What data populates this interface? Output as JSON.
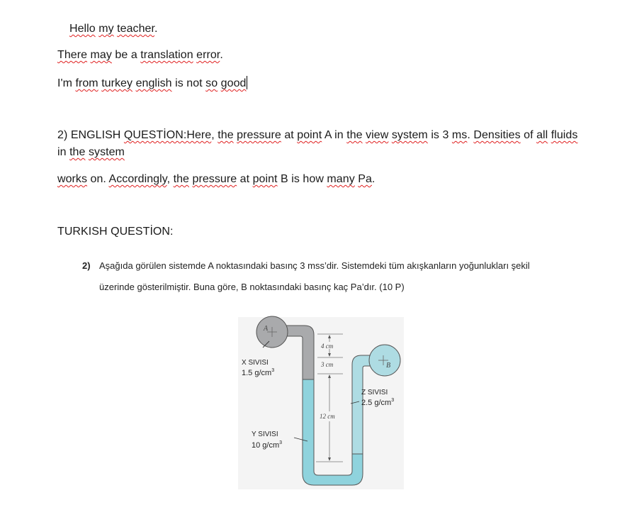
{
  "intro": {
    "line1": [
      "Hello",
      " ",
      "my",
      " ",
      "teacher",
      "."
    ],
    "line2": [
      "There",
      " ",
      "may",
      " be a ",
      "translation",
      " ",
      "error",
      "."
    ],
    "line3": [
      "I'm ",
      "from",
      " ",
      "turkey",
      " ",
      "english",
      " is not ",
      "so",
      " ",
      "good"
    ]
  },
  "english_question": {
    "line1": [
      "2) ENGLISH ",
      "QUESTİON:Here",
      ", ",
      "the",
      " ",
      "pressure",
      " at ",
      "point",
      " A in ",
      "the",
      " ",
      "view",
      " ",
      "system",
      " is 3 ",
      "ms",
      ". ",
      "Densities",
      " of ",
      "all",
      " ",
      "fluids"
    ],
    "line2": [
      "in ",
      "the",
      " ",
      "system"
    ],
    "line3": [
      "works",
      " on. ",
      "Accordingly",
      ", ",
      "the",
      " ",
      "pressure",
      " at ",
      "point",
      " B is how ",
      "many",
      " ",
      "Pa",
      "."
    ]
  },
  "turkish_heading": "TURKISH QUESTİON:",
  "turkish_question": {
    "number": "2)",
    "line1": "Aşağıda görülen sistemde A noktasındaki basınç 3 mss’dir. Sistemdeki tüm akışkanların yoğunlukları şekil",
    "line2": "üzerinde gösterilmiştir. Buna göre, B noktasındaki basınç kaç Pa’dır. (10 P)"
  },
  "diagram": {
    "point_a": "A",
    "point_b": "B",
    "fluid_x": {
      "name": "X SIVISI",
      "density": "1.5 g/cm",
      "sup": "3",
      "color": "#a9aaac"
    },
    "fluid_y": {
      "name": "Y SIVISI",
      "density": "10 g/cm",
      "sup": "3",
      "color": "#8fd3dd"
    },
    "fluid_z": {
      "name": "Z SIVISI",
      "density": "2.5 g/cm",
      "sup": "3",
      "color": "#aedce3"
    },
    "dim_top": {
      "value": "4",
      "unit": "cm"
    },
    "dim_mid": {
      "value": "3",
      "unit": "cm"
    },
    "dim_long": {
      "value": "12",
      "unit": "cm"
    }
  }
}
